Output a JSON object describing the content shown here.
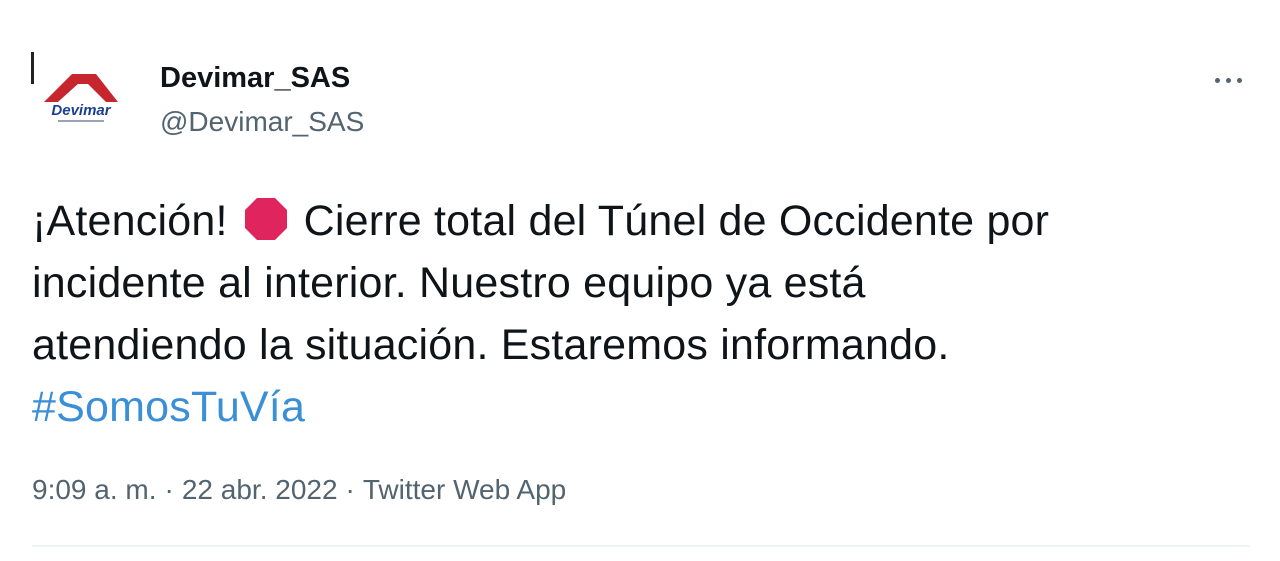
{
  "author": {
    "display_name": "Devimar_SAS",
    "handle": "@Devimar_SAS",
    "avatar_text": "Devimar"
  },
  "tweet": {
    "line1_before_icon": "¡Atención!",
    "line1_after_icon": "Cierre total del Túnel de Occidente por",
    "line2": "incidente al interior. Nuestro equipo ya está",
    "line3": "atendiendo la situación. Estaremos informando.",
    "hashtag": "#SomosTuVía"
  },
  "meta": {
    "time": "9:09 a. m.",
    "date": "22 abr. 2022",
    "source": "Twitter Web App",
    "separator": "·"
  },
  "icons": {
    "stop": "octagonal-sign-icon",
    "more": "more-dots-icon"
  },
  "colors": {
    "text": "#0f1419",
    "secondary": "#536471",
    "hashtag": "#3a8fd6",
    "stop_sign": "#e0245e",
    "logo_red": "#c8262f",
    "logo_blue": "#1b3f8f"
  }
}
